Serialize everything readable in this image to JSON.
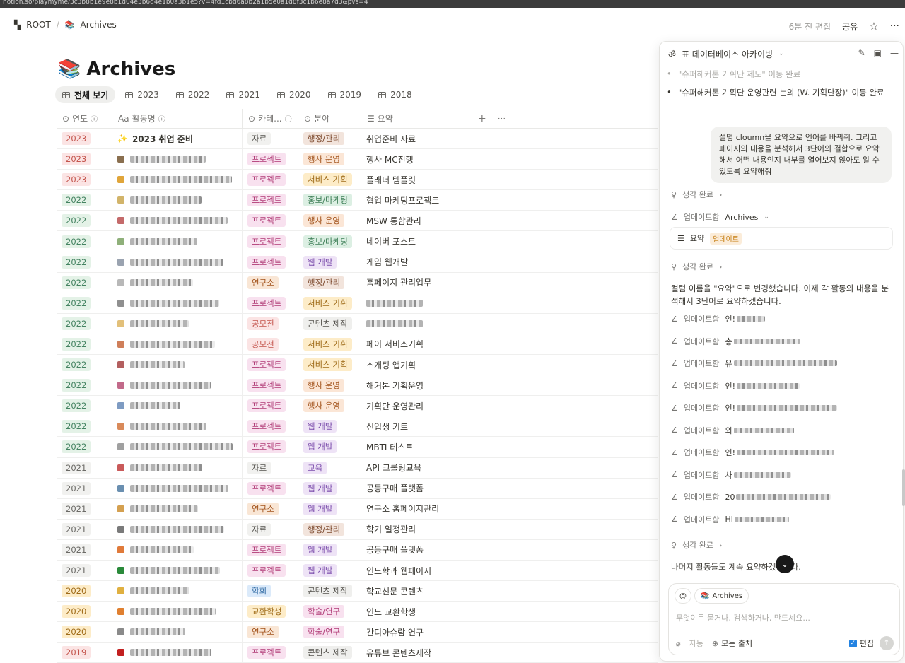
{
  "browser": {
    "url": "notion.so/playmyme/3c3b8b1e9e8b1d04e3b6d4e1b0a3b1e5?v=4fd1cbd6a8b2a1b5e0a1d8f3c1b6e8a7d3&pvs=4"
  },
  "breadcrumb": {
    "root": "ROOT",
    "page": "Archives"
  },
  "topbar": {
    "edited": "6분 전 편집",
    "share": "공유"
  },
  "page": {
    "title": "Archives",
    "emoji": "📚"
  },
  "tabs": [
    "전체 보기",
    "2023",
    "2022",
    "2021",
    "2020",
    "2019",
    "2018"
  ],
  "columns": {
    "year": "연도",
    "activity": "활동명",
    "category": "카테...",
    "field": "분야",
    "summary": "요약"
  },
  "colors": {
    "2023": [
      "#fbe4e4",
      "#c4554d"
    ],
    "2022": [
      "#e4f2e7",
      "#448361"
    ],
    "2021": [
      "#f1f1ef",
      "#6b6a66"
    ],
    "2020": [
      "#fdecc8",
      "#9f6b18"
    ],
    "2019": [
      "#fbe4e4",
      "#c4554d"
    ],
    "자료": [
      "#f1f1ef",
      "#55534e"
    ],
    "프로젝트": [
      "#f8e1ef",
      "#b03a76"
    ],
    "연구소": [
      "#f9e6d5",
      "#a3541d"
    ],
    "공모전": [
      "#fbe4e4",
      "#c4554d"
    ],
    "학회": [
      "#dbeafa",
      "#2f6aa3"
    ],
    "교환학생": [
      "#fdecc8",
      "#9f6b18"
    ],
    "행정/관리": [
      "#f2e4dc",
      "#7d4a2e"
    ],
    "행사 운영": [
      "#fbe6d6",
      "#a3541d"
    ],
    "서비스 기획": [
      "#fdecc8",
      "#9f6b18"
    ],
    "홍보/마케팅": [
      "#dcefe3",
      "#3b7d55"
    ],
    "웹 개발": [
      "#eee3f6",
      "#7a4bab"
    ],
    "콘텐츠 제작": [
      "#efefed",
      "#55534e"
    ],
    "교육": [
      "#eee3f6",
      "#7a4bab"
    ],
    "학술/연구": [
      "#f8e1ef",
      "#b03a76"
    ]
  },
  "rows": [
    {
      "year": "2023",
      "name": "2023 취업 준비",
      "icon": "✨",
      "cat": "자료",
      "field": "행정/관리",
      "summary": "취업준비 자료"
    },
    {
      "year": "2023",
      "name": "",
      "cat": "프로젝트",
      "field": "행사 운영",
      "summary": "행사 MC진행"
    },
    {
      "year": "2023",
      "name": "",
      "cat": "프로젝트",
      "field": "서비스 기획",
      "summary": "플래너 템플릿"
    },
    {
      "year": "2022",
      "name": "",
      "cat": "프로젝트",
      "field": "홍보/마케팅",
      "summary": "협업 마케팅프로젝트"
    },
    {
      "year": "2022",
      "name": "",
      "cat": "프로젝트",
      "field": "행사 운영",
      "summary": "MSW 통합관리"
    },
    {
      "year": "2022",
      "name": "",
      "cat": "프로젝트",
      "field": "홍보/마케팅",
      "summary": "네이버 포스트"
    },
    {
      "year": "2022",
      "name": "",
      "cat": "프로젝트",
      "field": "웹 개발",
      "summary": "게임 웹개발"
    },
    {
      "year": "2022",
      "name": "",
      "cat": "연구소",
      "field": "행정/관리",
      "summary": "홈페이지 관리업무"
    },
    {
      "year": "2022",
      "name": "",
      "cat": "프로젝트",
      "field": "서비스 기획",
      "summary": ""
    },
    {
      "year": "2022",
      "name": "",
      "cat": "공모전",
      "field": "콘텐츠 제작",
      "summary": ""
    },
    {
      "year": "2022",
      "name": "",
      "cat": "공모전",
      "field": "서비스 기획",
      "summary": "페이 서비스기획"
    },
    {
      "year": "2022",
      "name": "",
      "cat": "프로젝트",
      "field": "서비스 기획",
      "summary": "소개팅 앱기획"
    },
    {
      "year": "2022",
      "name": "",
      "cat": "프로젝트",
      "field": "행사 운영",
      "summary": "해커톤 기획운영"
    },
    {
      "year": "2022",
      "name": "",
      "cat": "프로젝트",
      "field": "행사 운영",
      "summary": "기획단 운영관리"
    },
    {
      "year": "2022",
      "name": "",
      "cat": "프로젝트",
      "field": "웹 개발",
      "summary": "신입생 키트"
    },
    {
      "year": "2022",
      "name": "",
      "cat": "프로젝트",
      "field": "웹 개발",
      "summary": "MBTI 테스트"
    },
    {
      "year": "2021",
      "name": "",
      "cat": "자료",
      "field": "교육",
      "summary": "API 크롤링교육"
    },
    {
      "year": "2021",
      "name": "",
      "cat": "프로젝트",
      "field": "웹 개발",
      "summary": "공동구매 플랫폼"
    },
    {
      "year": "2021",
      "name": "",
      "cat": "연구소",
      "field": "웹 개발",
      "summary": "연구소 홈페이지관리"
    },
    {
      "year": "2021",
      "name": "",
      "cat": "자료",
      "field": "행정/관리",
      "summary": "학기 일정관리"
    },
    {
      "year": "2021",
      "name": "",
      "cat": "프로젝트",
      "field": "웹 개발",
      "summary": "공동구매 플랫폼"
    },
    {
      "year": "2021",
      "name": "",
      "cat": "프로젝트",
      "field": "웹 개발",
      "summary": "인도학과 웹페이지"
    },
    {
      "year": "2020",
      "name": "",
      "cat": "학회",
      "field": "콘텐츠 제작",
      "summary": "학교신문 콘텐츠"
    },
    {
      "year": "2020",
      "name": "",
      "cat": "교환학생",
      "field": "학술/연구",
      "summary": "인도 교환학생"
    },
    {
      "year": "2020",
      "name": "",
      "cat": "연구소",
      "field": "학술/연구",
      "summary": "간디아슈람 연구"
    },
    {
      "year": "2019",
      "name": "",
      "cat": "프로젝트",
      "field": "콘텐츠 제작",
      "summary": "유튜브 콘텐츠제작"
    }
  ],
  "panel": {
    "title": "표 데이터베이스 아카이빙",
    "prev_items": [
      "\"슈퍼해커톤 기획단 제도\" 이동 완료",
      "\"슈퍼해커톤 기획단 운영관련 논의 (W. 기획단장)\" 이동 완료"
    ],
    "user_message": "설명 cloumn을 요약으로 언어를 바꿔줘. 그리고 페이지의 내용을 분석해서 3단어의 결합으로 요약해서 어떤 내용인지 내부를 열어보지 않아도 알 수 있도록 요약해줘",
    "thought": "생각 완료",
    "updated": "업데이트함",
    "updated_target": "Archives",
    "summary_prop": "요약",
    "update_badge": "업데이트",
    "reply": "컬럼 이름을 \"요약\"으로 변경했습니다. 이제 각 활동의 내용을 분석해서 3단어로 요약하겠습니다.",
    "update_prefixes": [
      "인!",
      "총",
      "유",
      "인!",
      "인!",
      "외",
      "인!",
      "사",
      "20",
      "Hi"
    ],
    "final": "나머지 활동들도 계속 요약하겠습니다.",
    "chip": "Archives",
    "placeholder": "무엇이든 묻거나, 검색하거나, 만드세요...",
    "auto": "자동",
    "sources": "모든 출처",
    "edit": "편집"
  }
}
